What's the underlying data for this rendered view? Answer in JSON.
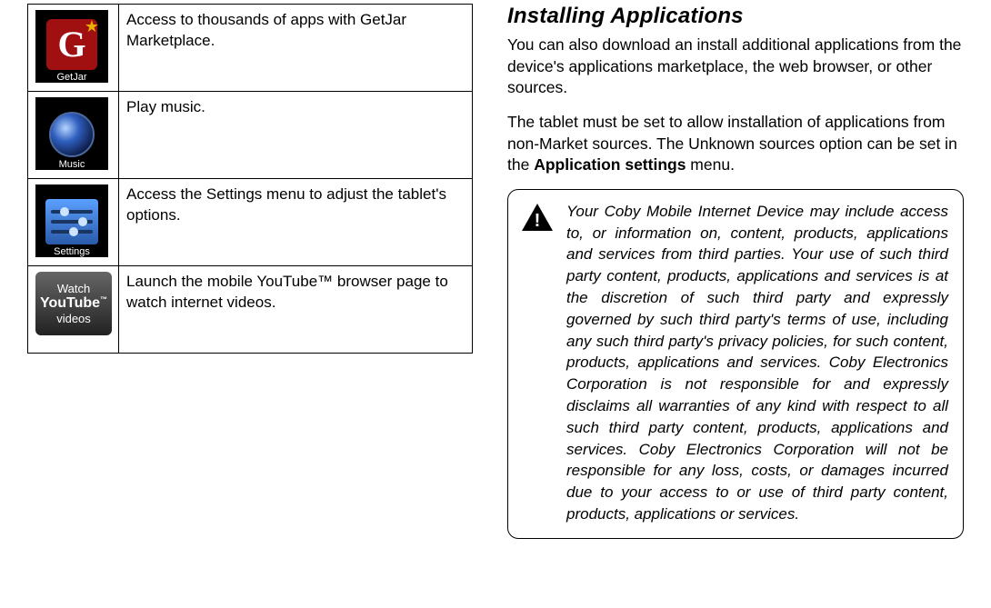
{
  "apps": [
    {
      "name": "GetJar",
      "desc": "Access to thousands of apps with GetJar Marketplace."
    },
    {
      "name": "Music",
      "desc": "Play music."
    },
    {
      "name": "Settings",
      "desc": "Access the Settings menu to adjust the tablet's options."
    },
    {
      "name": "Watch YouTube videos",
      "desc": "Launch the mobile YouTube™ browser page to watch internet videos."
    }
  ],
  "section_title": "Installing Applications",
  "para1": "You can also download an install additional applications from the device's applications marketplace, the web browser, or other sources.",
  "para2_a": "The tablet must be set to allow installation of applications from non-Market sources. The Unknown sources option can be set in the ",
  "para2_b": "Application settings",
  "para2_c": " menu.",
  "callout": "Your Coby Mobile Internet Device may include access to, or information on, content, products, applications and services from third parties. Your use of such third party content, products, applications and services is at the discretion of such third party and expressly governed by such third party's terms of use, including any such third party's privacy policies, for such content, products, applications and services. Coby Electronics Corporation is not responsible for and expressly disclaims all warranties of any kind with respect to all such third party content, products, applications and services. Coby Electronics Corporation will not be responsible for any loss, costs, or damages incurred due to your access to or use of third party content, products, applications or services.",
  "yt_lines": {
    "l1": "Watch",
    "l2": "YouTube",
    "l3": "videos"
  }
}
